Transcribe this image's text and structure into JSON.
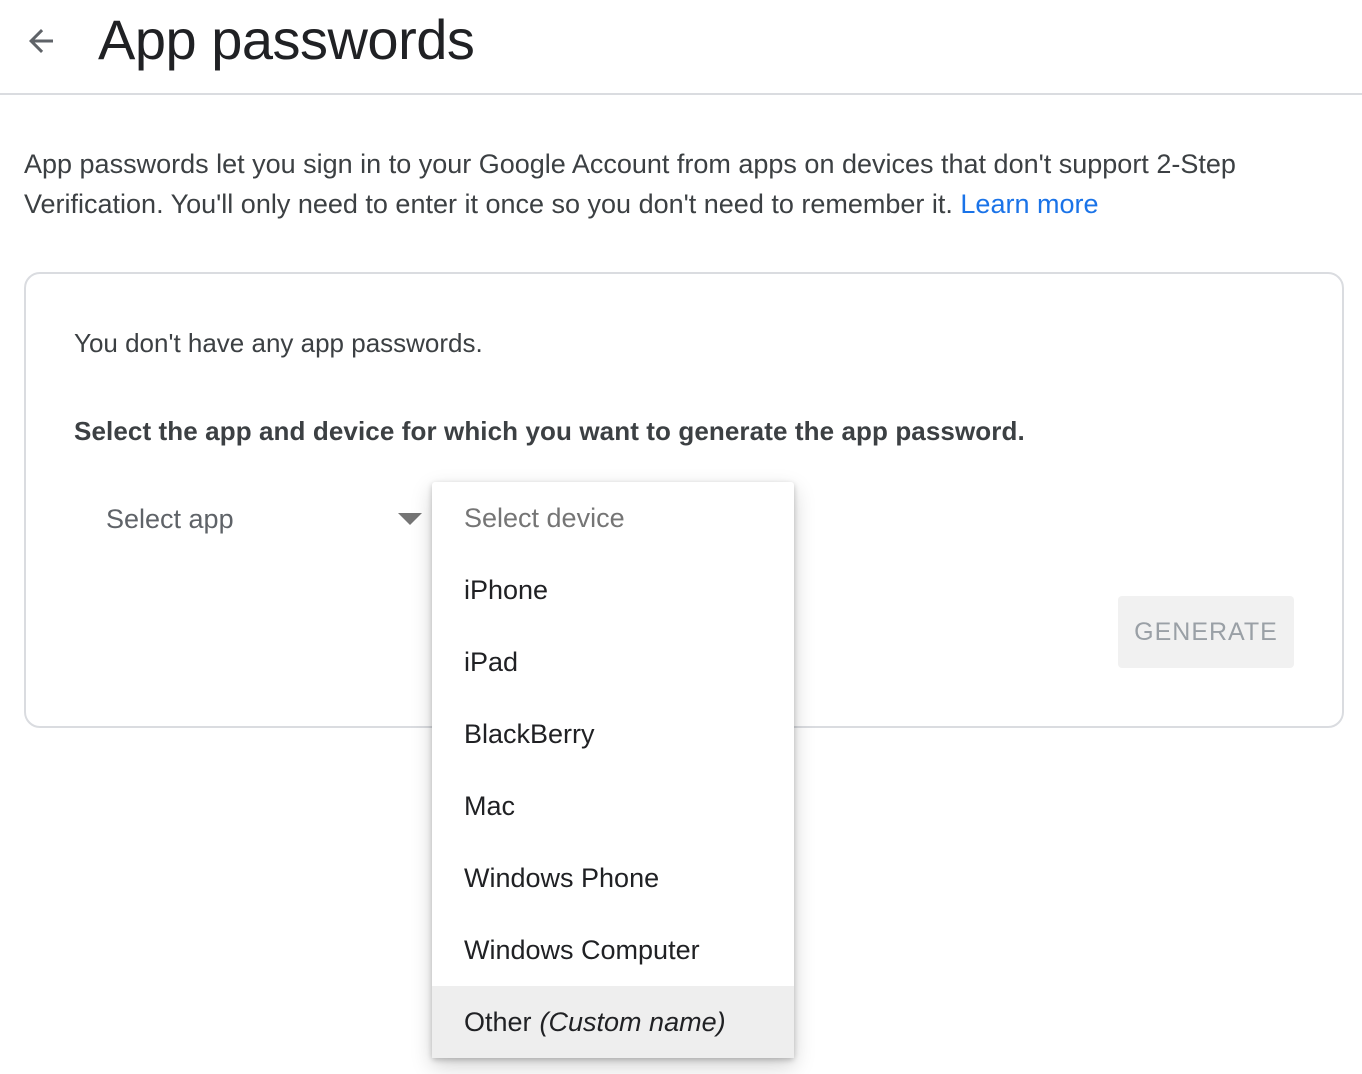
{
  "header": {
    "title": "App passwords",
    "back_icon": "arrow-left-icon"
  },
  "intro": {
    "text": "App passwords let you sign in to your Google Account from apps on devices that don't support 2-Step Verification. You'll only need to enter it once so you don't need to remember it.",
    "learn_more": "Learn more",
    "link_color": "#1a73e8"
  },
  "card": {
    "no_passwords": "You don't have any app passwords.",
    "instruction": "Select the app and device for which you want to generate the app password.",
    "select_app": "Select app",
    "generate": "GENERATE"
  },
  "device_menu": {
    "placeholder": "Select device",
    "items": [
      "iPhone",
      "iPad",
      "BlackBerry",
      "Mac",
      "Windows Phone",
      "Windows Computer"
    ],
    "other_label": "Other",
    "other_hint": "(Custom name)"
  }
}
